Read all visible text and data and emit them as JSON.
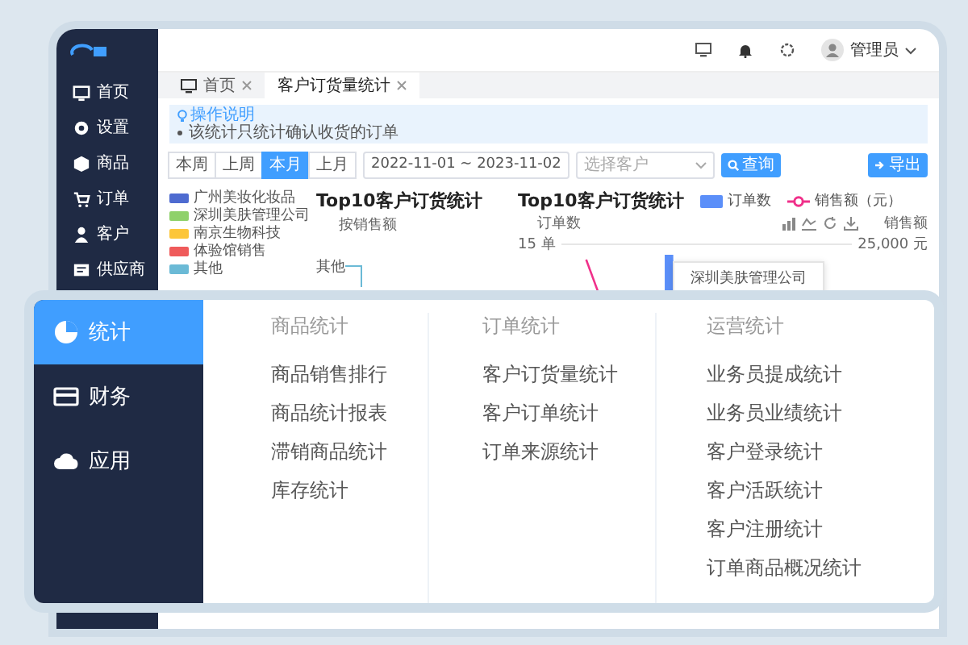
{
  "sidebar": {
    "items": [
      {
        "label": "首页"
      },
      {
        "label": "设置"
      },
      {
        "label": "商品"
      },
      {
        "label": "订单"
      },
      {
        "label": "客户"
      },
      {
        "label": "供应商"
      }
    ]
  },
  "header": {
    "user": "管理员"
  },
  "tabs": [
    {
      "label": "首页",
      "selected": false
    },
    {
      "label": "客户订货量统计",
      "selected": true
    }
  ],
  "notice": {
    "title": "操作说明",
    "items": [
      "该统计只统计确认收货的订单"
    ]
  },
  "periods": [
    {
      "label": "本周",
      "selected": false
    },
    {
      "label": "上周",
      "selected": false
    },
    {
      "label": "本月",
      "selected": true
    },
    {
      "label": "上月",
      "selected": false
    }
  ],
  "date_range": {
    "value": "2022-11-01 ~ 2023-11-02"
  },
  "customer_select": {
    "placeholder": "选择客户"
  },
  "query_button": "查询",
  "export_button": "导出",
  "pie_chart": {
    "title": "Top10客户订货统计",
    "subtitle": "按销售额",
    "slice_label": "其他",
    "legend": [
      {
        "label": "广州美妆化妆品",
        "color": "#4e6bd0"
      },
      {
        "label": "深圳美肤管理公司",
        "color": "#8fd16b"
      },
      {
        "label": "南京生物科技",
        "color": "#fcc63a"
      },
      {
        "label": "体验馆销售",
        "color": "#ef5b5b"
      },
      {
        "label": "其他",
        "color": "#6bbad6"
      }
    ]
  },
  "combo_chart": {
    "title": "Top10客户订货统计",
    "left_axis": "订单数",
    "right_axis": "销售额",
    "left_tick": "15 单",
    "right_tick": "25,000 元",
    "tooltip": "深圳美肤管理公司",
    "legend": [
      {
        "label": "订单数",
        "kind": "bar",
        "color": "#5b8ff9"
      },
      {
        "label": "销售额（元）",
        "kind": "line",
        "color": "#f0308a"
      }
    ]
  },
  "menu": {
    "categories": [
      {
        "label": "统计",
        "selected": true
      },
      {
        "label": "财务",
        "selected": false
      },
      {
        "label": "应用",
        "selected": false
      }
    ],
    "groups": [
      {
        "title": "商品统计",
        "items": [
          "商品销售排行",
          "商品统计报表",
          "滞销商品统计",
          "库存统计"
        ]
      },
      {
        "title": "订单统计",
        "items": [
          "客户订货量统计",
          "客户订单统计",
          "订单来源统计"
        ]
      },
      {
        "title": "运营统计",
        "items": [
          "业务员提成统计",
          "业务员业绩统计",
          "客户登录统计",
          "客户活跃统计",
          "客户注册统计",
          "订单商品概况统计"
        ]
      }
    ]
  }
}
